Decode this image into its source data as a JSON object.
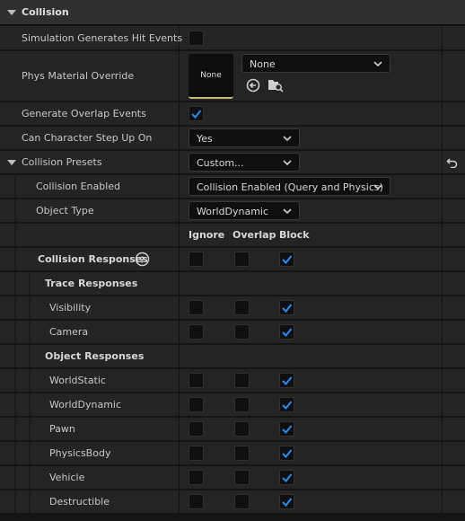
{
  "section": {
    "title": "Collision"
  },
  "rows": {
    "sim_hit": "Simulation Generates Hit Events",
    "phys_mat": "Phys Material Override",
    "phys_mat_thumb": "None",
    "phys_mat_value": "None",
    "overlap": "Generate Overlap Events",
    "step_up": "Can Character Step Up On",
    "step_up_value": "Yes",
    "presets": "Collision Presets",
    "presets_value": "Custom...",
    "enabled": "Collision Enabled",
    "enabled_value": "Collision Enabled (Query and Physics)",
    "object_type": "Object Type",
    "object_type_value": "WorldDynamic"
  },
  "columns": {
    "ignore": "Ignore",
    "overlap": "Overlap",
    "block": "Block"
  },
  "responses": {
    "title": "Collision Responses",
    "trace_title": "Trace Responses",
    "object_title": "Object Responses",
    "trace": [
      "Visibility",
      "Camera"
    ],
    "object": [
      "WorldStatic",
      "WorldDynamic",
      "Pawn",
      "PhysicsBody",
      "Vehicle",
      "Destructible"
    ]
  },
  "colors": {
    "check": "#2a8bf0",
    "accent": "#c9b77a"
  },
  "state": {
    "sim_hit_checked": false,
    "overlap_checked": true,
    "responses_block_all": true
  }
}
